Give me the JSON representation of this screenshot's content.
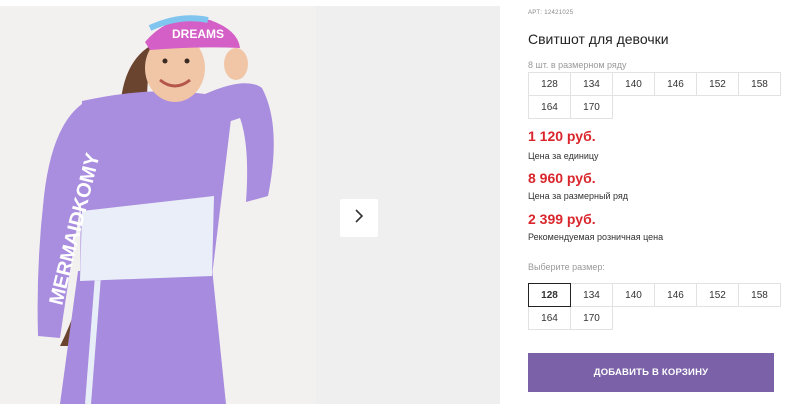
{
  "product": {
    "article": "АРТ: 12421025",
    "title": "Свитшот для девочки",
    "pack_note": "8 шт. в размерном ряду",
    "pack_sizes": [
      "128",
      "134",
      "140",
      "146",
      "152",
      "158",
      "164",
      "170"
    ],
    "prices": [
      {
        "value": "1 120 руб.",
        "label": "Цена за единицу"
      },
      {
        "value": "8 960 руб.",
        "label": "Цена за размерный ряд"
      },
      {
        "value": "2 399 руб.",
        "label": "Рекомендуемая розничная цена"
      }
    ],
    "select_size_label": "Выберите размер:",
    "sizes": [
      "128",
      "134",
      "140",
      "146",
      "152",
      "158",
      "164",
      "170"
    ],
    "selected_size": "128",
    "add_to_cart": "ДОБАВИТЬ В КОРЗИНУ"
  },
  "photo": {
    "cap_text": "DREAMS",
    "sweatshirt_text": "MERMAIDKOMY",
    "sweatshirt_color": "#a98ddf",
    "sweatshirt_band_color": "#e9eef8"
  },
  "colors": {
    "price": "#d9262d",
    "button": "#7b62a8"
  },
  "icons": {
    "next": "chevron-right-icon"
  }
}
